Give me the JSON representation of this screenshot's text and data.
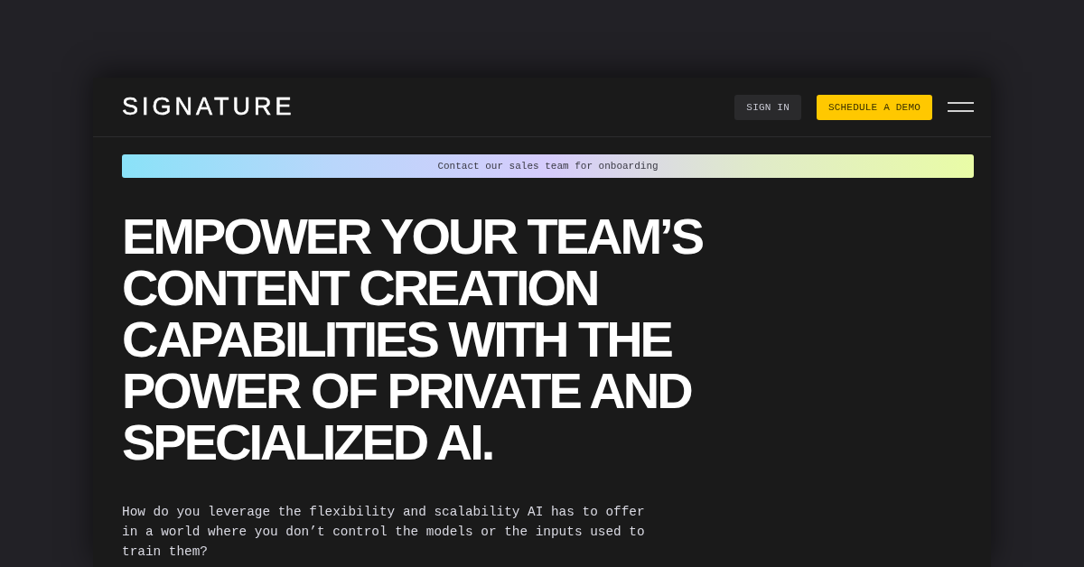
{
  "header": {
    "logo": "SIGNATURE",
    "buttons": [
      {
        "label": "SIGN IN",
        "kind": "secondary"
      },
      {
        "label": "SCHEDULE A DEMO",
        "kind": "primary"
      }
    ]
  },
  "banner": {
    "text": "Contact our sales team for onboarding"
  },
  "hero": {
    "headline": "EMPOWER YOUR TEAM’S CONTENT CREATION CAPABILITIES WITH THE POWER OF PRIVATE AND SPECIALIZED AI.",
    "description": "How do you leverage the flexibility and scalability AI has to offer in a world where you don’t control the models or the inputs used to train them?"
  }
}
